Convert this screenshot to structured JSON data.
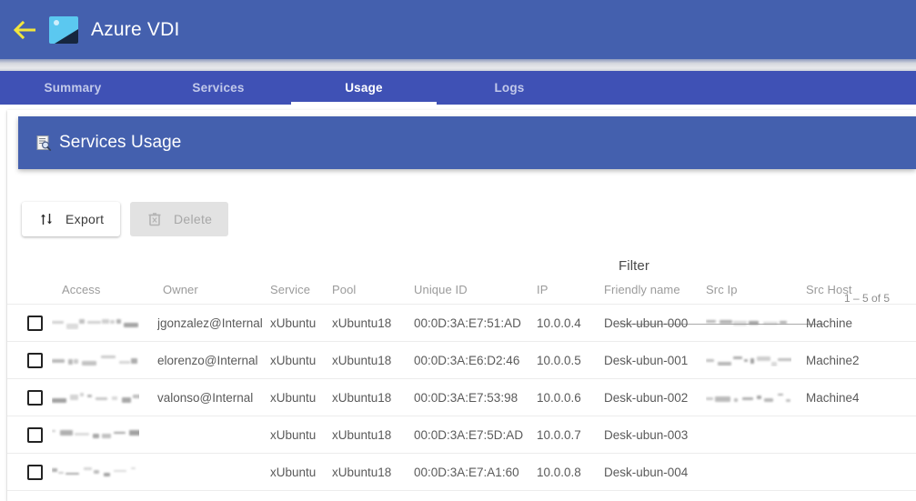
{
  "app_bar": {
    "back_icon": "arrow-left-icon",
    "logo_icon": "image-picture-icon",
    "title": "Azure VDI",
    "background": "#4460AE",
    "back_icon_color": "#F2E63C"
  },
  "tabs": {
    "active": "Usage",
    "background": "#3F51B5",
    "items": [
      {
        "label": "Summary",
        "active": false
      },
      {
        "label": "Services",
        "active": false
      },
      {
        "label": "Usage",
        "active": true
      },
      {
        "label": "Logs",
        "active": false
      }
    ]
  },
  "card": {
    "header": {
      "icon": "document-search-icon",
      "title": "Services Usage",
      "background": "#4460AE"
    }
  },
  "toolbar": {
    "export": {
      "label": "Export",
      "icon": "import-export-arrows-icon",
      "disabled": false
    },
    "delete": {
      "label": "Delete",
      "icon": "trash-can-icon",
      "disabled": true
    }
  },
  "filter": {
    "label": "Filter",
    "value": "",
    "placeholder": ""
  },
  "paginator": {
    "range_label": "1 – 5 of 5"
  },
  "table": {
    "columns": [
      "Access",
      "Owner",
      "Service",
      "Pool",
      "Unique ID",
      "IP",
      "Friendly name",
      "Src Ip",
      "Src Host"
    ],
    "rows": [
      {
        "selected": false,
        "access": "[redacted]",
        "owner": "jgonzalez@Internal",
        "service": "xUbuntu",
        "pool": "xUbuntu18",
        "unique_id": "00:0D:3A:E7:51:AD",
        "ip": "10.0.0.4",
        "friendly_name": "Desk-ubun-000",
        "src_ip": "[redacted]",
        "src_host": "Machine"
      },
      {
        "selected": false,
        "access": "[redacted]",
        "owner": "elorenzo@Internal",
        "service": "xUbuntu",
        "pool": "xUbuntu18",
        "unique_id": "00:0D:3A:E6:D2:46",
        "ip": "10.0.0.5",
        "friendly_name": "Desk-ubun-001",
        "src_ip": "[redacted]",
        "src_host": "Machine2"
      },
      {
        "selected": false,
        "access": "[redacted]",
        "owner": "valonso@Internal",
        "service": "xUbuntu",
        "pool": "xUbuntu18",
        "unique_id": "00:0D:3A:E7:53:98",
        "ip": "10.0.0.6",
        "friendly_name": "Desk-ubun-002",
        "src_ip": "[redacted]",
        "src_host": "Machine4"
      },
      {
        "selected": false,
        "access": "[redacted]",
        "owner": "",
        "service": "xUbuntu",
        "pool": "xUbuntu18",
        "unique_id": "00:0D:3A:E7:5D:AD",
        "ip": "10.0.0.7",
        "friendly_name": "Desk-ubun-003",
        "src_ip": "",
        "src_host": ""
      },
      {
        "selected": false,
        "access": "[redacted]",
        "owner": "",
        "service": "xUbuntu",
        "pool": "xUbuntu18",
        "unique_id": "00:0D:3A:E7:A1:60",
        "ip": "10.0.0.8",
        "friendly_name": "Desk-ubun-004",
        "src_ip": "",
        "src_host": ""
      }
    ]
  }
}
